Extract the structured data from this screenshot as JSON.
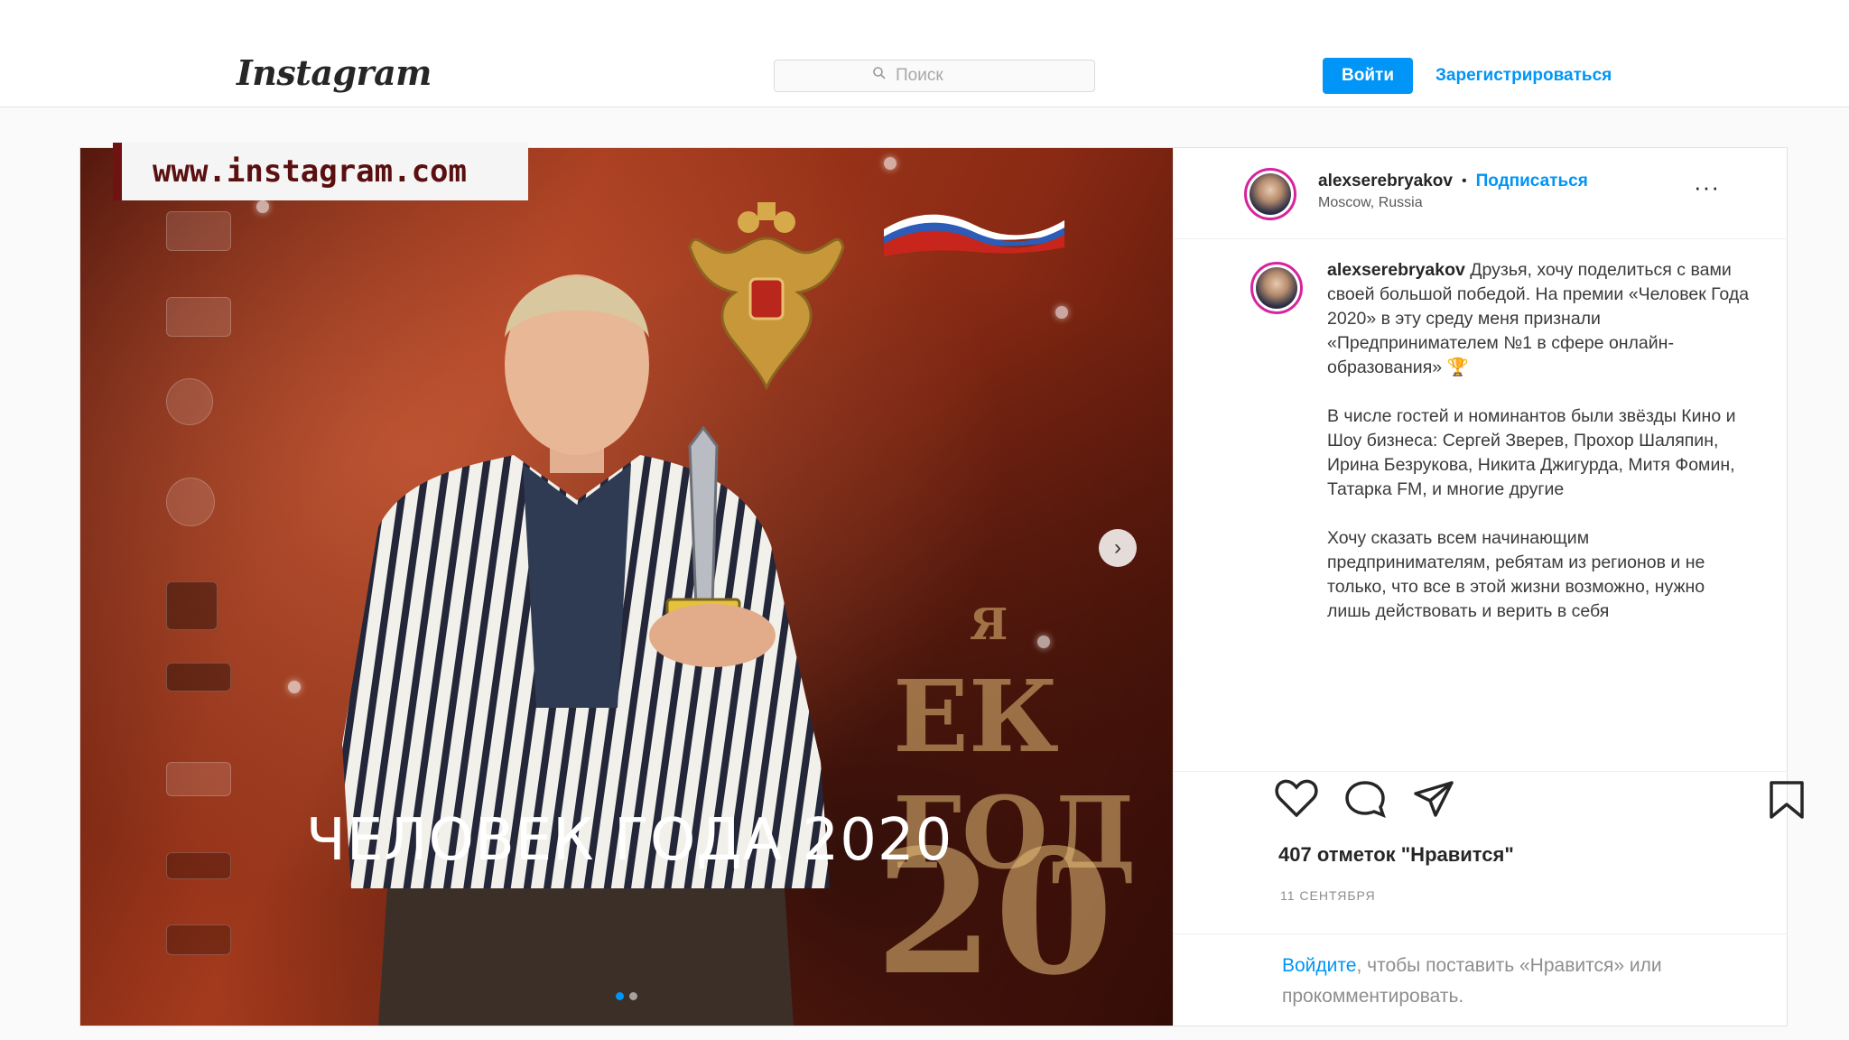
{
  "header": {
    "logo_text": "Instagram",
    "search_placeholder": "Поиск",
    "login_label": "Войти",
    "signup_label": "Зарегистрироваться"
  },
  "watermark": {
    "text": "www.instagram.com"
  },
  "media": {
    "overlay_caption": "ЧЕЛОВЕК ГОДА 2020",
    "background_text_1": "ЕК ГОД",
    "background_text_2": "20",
    "background_text_3": "Я",
    "slide_count": 2,
    "active_slide": 1
  },
  "post": {
    "author": "alexserebryakov",
    "separator": "•",
    "follow_label": "Подписаться",
    "location": "Moscow, Russia",
    "more_label": "···",
    "caption_paragraphs": [
      "Друзья, хочу поделиться с вами своей большой победой. На премии «Человек Года 2020» в эту среду меня признали «Предпринимателем №1 в сфере онлайн-образования» 🏆",
      "В числе гостей и номинантов были звёзды Кино и Шоу бизнеса: Сергей Зверев, Прохор Шаляпин, Ирина Безрукова, Никита Джигурда, Митя Фомин, Татарка FM, и многие другие",
      "Хочу сказать всем начинающим предпринимателям, ребятам из регионов и не только, что все в этой жизни возможно, нужно лишь действовать и верить в себя"
    ],
    "likes_text": "407 отметок \"Нравится\"",
    "date_text": "11 СЕНТЯБРЯ",
    "login_prompt_link": "Войдите",
    "login_prompt_rest": ", чтобы поставить «Нравится» или прокомментировать."
  },
  "colors": {
    "accent_blue": "#0095f6",
    "watermark_red": "#6e1212"
  }
}
